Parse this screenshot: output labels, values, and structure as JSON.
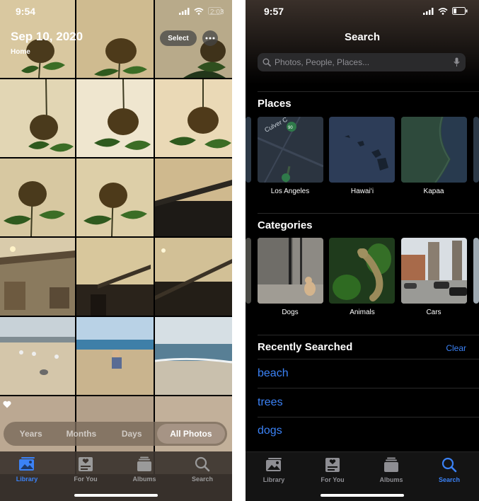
{
  "library": {
    "status_time": "9:54",
    "status_time_ghost": "2:03",
    "date_title": "Sep 10, 2020",
    "location": "Home",
    "select_label": "Select",
    "segments": [
      "Years",
      "Months",
      "Days",
      "All Photos"
    ],
    "active_segment": "All Photos",
    "tabs": [
      {
        "label": "Library",
        "icon": "photo-library-icon",
        "active": true
      },
      {
        "label": "For You",
        "icon": "for-you-icon",
        "active": false
      },
      {
        "label": "Albums",
        "icon": "albums-icon",
        "active": false
      },
      {
        "label": "Search",
        "icon": "search-icon",
        "active": false
      }
    ]
  },
  "search": {
    "status_time": "9:57",
    "title": "Search",
    "placeholder": "Photos, People, Places...",
    "places_title": "Places",
    "places": [
      {
        "label": "Los Angeles",
        "map_labels": [
          "Culver C",
          "90"
        ]
      },
      {
        "label": "Hawaiʻi"
      },
      {
        "label": "Kapaa"
      }
    ],
    "categories_title": "Categories",
    "categories": [
      {
        "label": "Dogs"
      },
      {
        "label": "Animals"
      },
      {
        "label": "Cars"
      }
    ],
    "recent_title": "Recently Searched",
    "clear_label": "Clear",
    "recent": [
      "beach",
      "trees",
      "dogs"
    ],
    "tabs": [
      {
        "label": "Library",
        "icon": "photo-library-icon",
        "active": false
      },
      {
        "label": "For You",
        "icon": "for-you-icon",
        "active": false
      },
      {
        "label": "Albums",
        "icon": "albums-icon",
        "active": false
      },
      {
        "label": "Search",
        "icon": "search-icon",
        "active": true
      }
    ]
  },
  "colors": {
    "accent": "#3b82f6",
    "inactive_tab": "#9a9a9a",
    "library_tabbar": "#3c342f"
  }
}
